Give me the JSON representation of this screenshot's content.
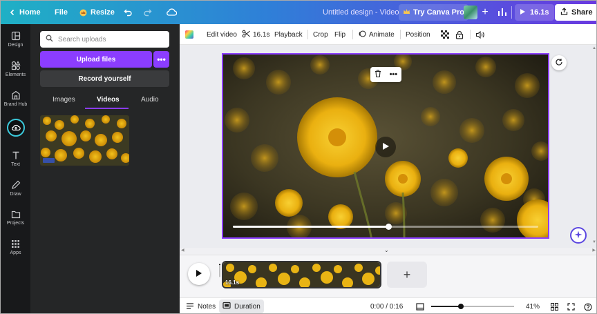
{
  "topbar": {
    "home": "Home",
    "file": "File",
    "resize": "Resize",
    "title": "Untitled design - Video",
    "try_pro": "Try Canva Pro",
    "duration": "16.1s",
    "share": "Share"
  },
  "rail": {
    "items": [
      "Design",
      "Elements",
      "Brand Hub",
      "Uploads",
      "Text",
      "Draw",
      "Projects",
      "Apps"
    ]
  },
  "panel": {
    "search_placeholder": "Search uploads",
    "upload_files": "Upload files",
    "more": "•••",
    "record": "Record yourself",
    "tabs": [
      "Images",
      "Videos",
      "Audio"
    ],
    "active_tab": "Videos"
  },
  "toolbar": {
    "edit_video": "Edit video",
    "duration": "16.1s",
    "playback": "Playback",
    "crop": "Crop",
    "flip": "Flip",
    "animate": "Animate",
    "position": "Position"
  },
  "canvas": {
    "playback_progress": 0.51
  },
  "timeline": {
    "clip_duration": "16.1s",
    "add": "+"
  },
  "bottombar": {
    "notes": "Notes",
    "duration": "Duration",
    "time": "0:00 / 0:16",
    "zoom": "41%",
    "zoom_level": 0.36
  },
  "colors": {
    "accent": "#8b3dff",
    "rail_bg": "#18191b",
    "panel_bg": "#252627"
  }
}
